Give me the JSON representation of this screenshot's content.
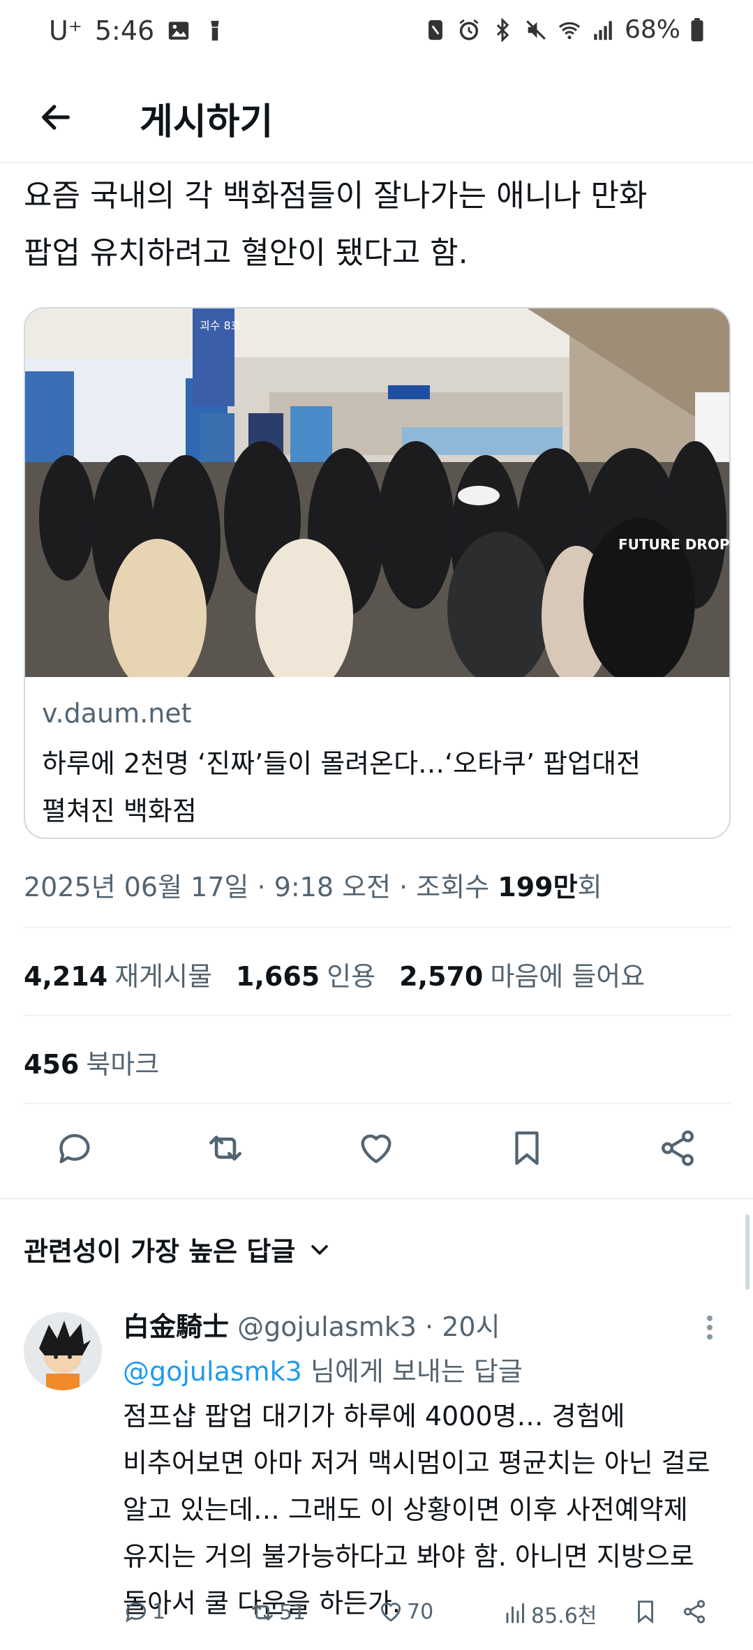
{
  "status_bar": {
    "carrier": "U⁺",
    "time": "5:46",
    "battery": "68%"
  },
  "header": {
    "title": "게시하기"
  },
  "tweet": {
    "text_line1": "요즘 국내의 각 백화점들이 잘나가는 애니나 만화",
    "text_line2": "팝업 유치하려고 혈안이 됐다고 함.",
    "card": {
      "domain": "v.daum.net",
      "title_line1": "하루에 2천명 ‘진짜’들이 몰려온다…‘오타쿠’ 팝업대전",
      "title_line2": "펼쳐진 백화점",
      "image_sign_text": "괴수 8호",
      "image_shirt_text": "FUTURE DROP"
    },
    "meta": {
      "date": "2025년 06월 17일",
      "sep1": " · ",
      "time": "9:18 오전",
      "sep2": " · ",
      "views_label": "조회수 ",
      "views_value": "199만",
      "views_suffix": "회"
    },
    "stats": {
      "retweets_value": "4,214",
      "retweets_label": "재게시물",
      "quotes_value": "1,665",
      "quotes_label": "인용",
      "likes_value": "2,570",
      "likes_label": "마음에 들어요",
      "bookmarks_value": "456",
      "bookmarks_label": "북마크"
    }
  },
  "replies": {
    "sort_label": "관련성이 가장 높은 답글",
    "items": [
      {
        "name": "白金騎士",
        "handle": "@gojulasmk3",
        "time_sep": " · ",
        "time": "20시",
        "reply_to_mention": "@gojulasmk3",
        "reply_to_suffix": " 님에게 보내는 답글",
        "body_lines": [
          "점프샵 팝업 대기가 하루에 4000명… 경험에",
          "비추어보면 아마 저거 맥시멈이고 평균치는 아닌 걸로",
          "알고 있는데… 그래도 이 상황이면 이후 사전예약제",
          "유지는 거의 불가능하다고 봐야 함. 아니면 지방으로",
          "돌아서 쿨 다운을 하든가."
        ],
        "reply_count": "1",
        "retweet_count": "51",
        "like_count": "70",
        "view_count": "85.6천"
      }
    ]
  },
  "colors": {
    "text_primary": "#0f1419",
    "text_secondary": "#536471",
    "link": "#1d9bf0",
    "border": "#cfd9de"
  }
}
